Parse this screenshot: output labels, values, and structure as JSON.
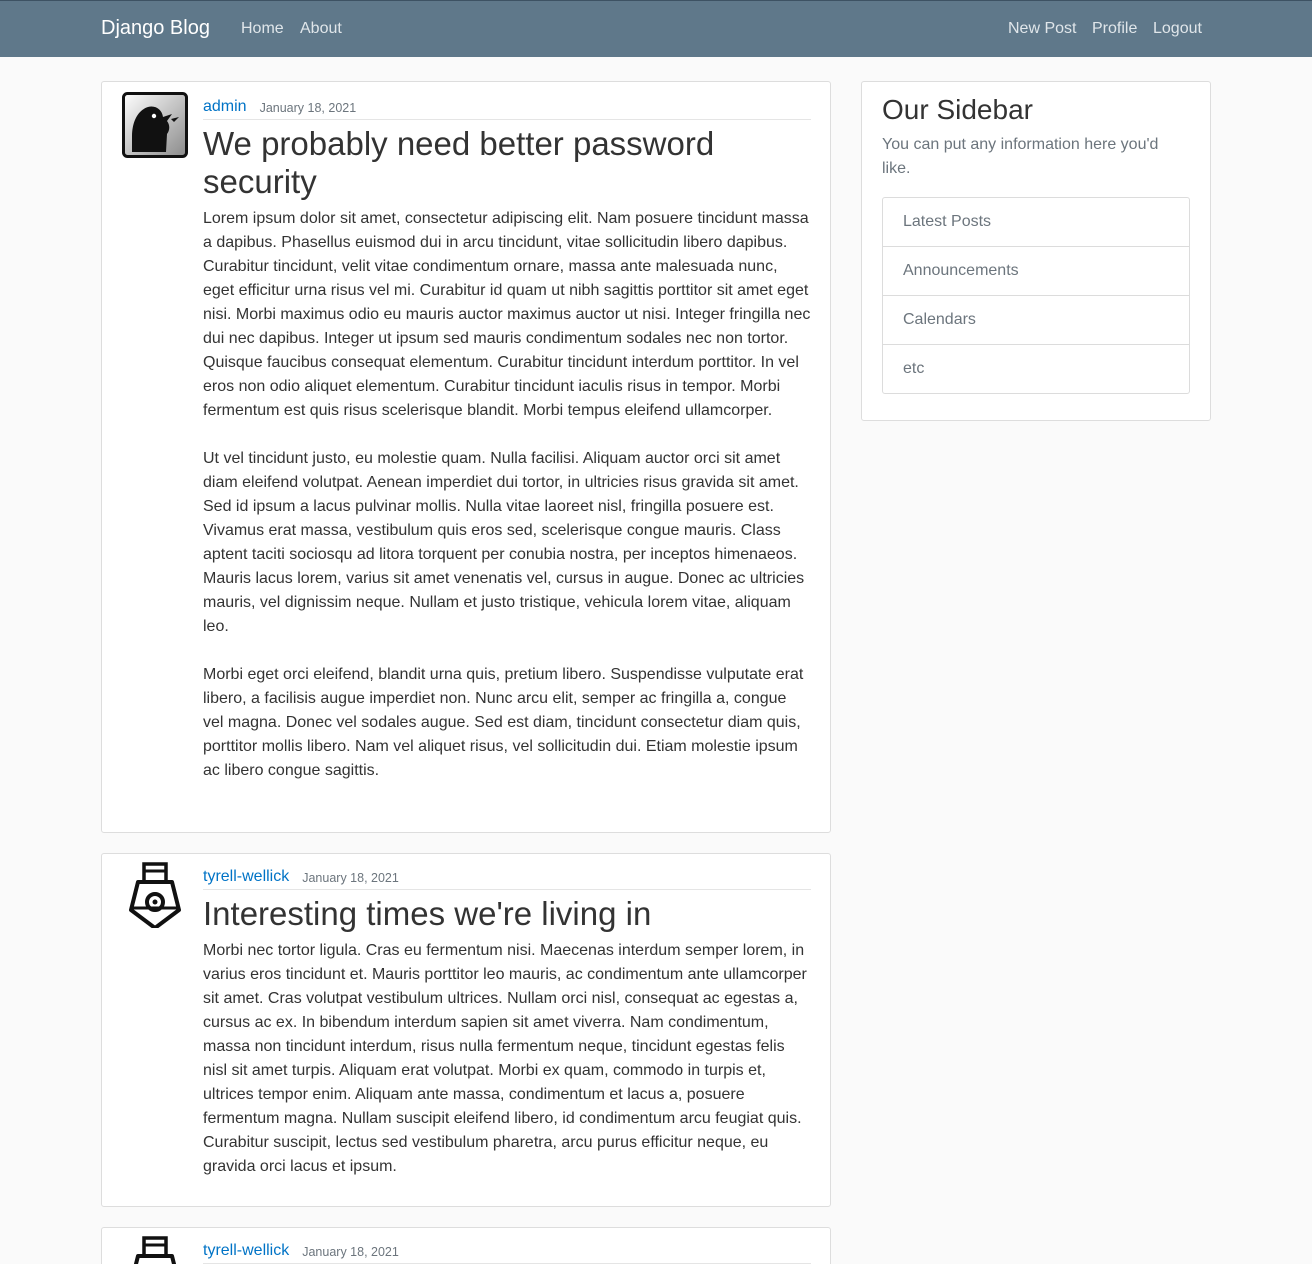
{
  "navbar": {
    "brand": "Django Blog",
    "links": [
      {
        "label": "Home"
      },
      {
        "label": "About"
      }
    ],
    "right_links": [
      {
        "label": "New Post"
      },
      {
        "label": "Profile"
      },
      {
        "label": "Logout"
      }
    ]
  },
  "posts": [
    {
      "author": "admin",
      "date": "January 18, 2021",
      "title": "We probably need better password security",
      "content": "Lorem ipsum dolor sit amet, consectetur adipiscing elit. Nam posuere tincidunt massa a dapibus. Phasellus euismod dui in arcu tincidunt, vitae sollicitudin libero dapibus. Curabitur tincidunt, velit vitae condimentum ornare, massa ante malesuada nunc, eget efficitur urna risus vel mi. Curabitur id quam ut nibh sagittis porttitor sit amet eget nisi. Morbi maximus odio eu mauris auctor maximus auctor ut nisi. Integer fringilla nec dui nec dapibus. Integer ut ipsum sed mauris condimentum sodales nec non tortor. Quisque faucibus consequat elementum. Curabitur tincidunt interdum porttitor. In vel eros non odio aliquet elementum. Curabitur tincidunt iaculis risus in tempor. Morbi fermentum est quis risus scelerisque blandit. Morbi tempus eleifend ullamcorper.\n\nUt vel tincidunt justo, eu molestie quam. Nulla facilisi. Aliquam auctor orci sit amet diam eleifend volutpat. Aenean imperdiet dui tortor, in ultricies risus gravida sit amet. Sed id ipsum a lacus pulvinar mollis. Nulla vitae laoreet nisl, fringilla posuere est. Vivamus erat massa, vestibulum quis eros sed, scelerisque congue mauris. Class aptent taciti sociosqu ad litora torquent per conubia nostra, per inceptos himenaeos. Mauris lacus lorem, varius sit amet venenatis vel, cursus in augue. Donec ac ultricies mauris, vel dignissim neque. Nullam et justo tristique, vehicula lorem vitae, aliquam leo.\n\nMorbi eget orci eleifend, blandit urna quis, pretium libero. Suspendisse vulputate erat libero, a facilisis augue imperdiet non. Nunc arcu elit, semper ac fringilla a, congue vel magna. Donec vel sodales augue. Sed est diam, tincidunt consectetur diam quis, porttitor mollis libero. Nam vel aliquet risus, vel sollicitudin dui. Etiam molestie ipsum ac libero congue sagittis."
    },
    {
      "author": "tyrell-wellick",
      "date": "January 18, 2021",
      "title": "Interesting times we're living in",
      "content": "Morbi nec tortor ligula. Cras eu fermentum nisi. Maecenas interdum semper lorem, in varius eros tincidunt et. Mauris porttitor leo mauris, ac condimentum ante ullamcorper sit amet. Cras volutpat vestibulum ultrices. Nullam orci nisl, consequat ac egestas a, cursus ac ex. In bibendum interdum sapien sit amet viverra. Nam condimentum, massa non tincidunt interdum, risus nulla fermentum neque, tincidunt egestas felis nisl sit amet turpis. Aliquam erat volutpat. Morbi ex quam, commodo in turpis et, ultrices tempor enim. Aliquam ante massa, condimentum et lacus a, posuere fermentum magna. Nullam suscipit eleifend libero, id condimentum arcu feugiat quis. Curabitur suscipit, lectus sed vestibulum pharetra, arcu purus efficitur neque, eu gravida orci lacus et ipsum."
    },
    {
      "author": "tyrell-wellick",
      "date": "January 18, 2021"
    }
  ],
  "sidebar": {
    "title": "Our Sidebar",
    "description": "You can put any information here you'd like.",
    "items": [
      "Latest Posts",
      "Announcements",
      "Calendars",
      "etc"
    ]
  }
}
